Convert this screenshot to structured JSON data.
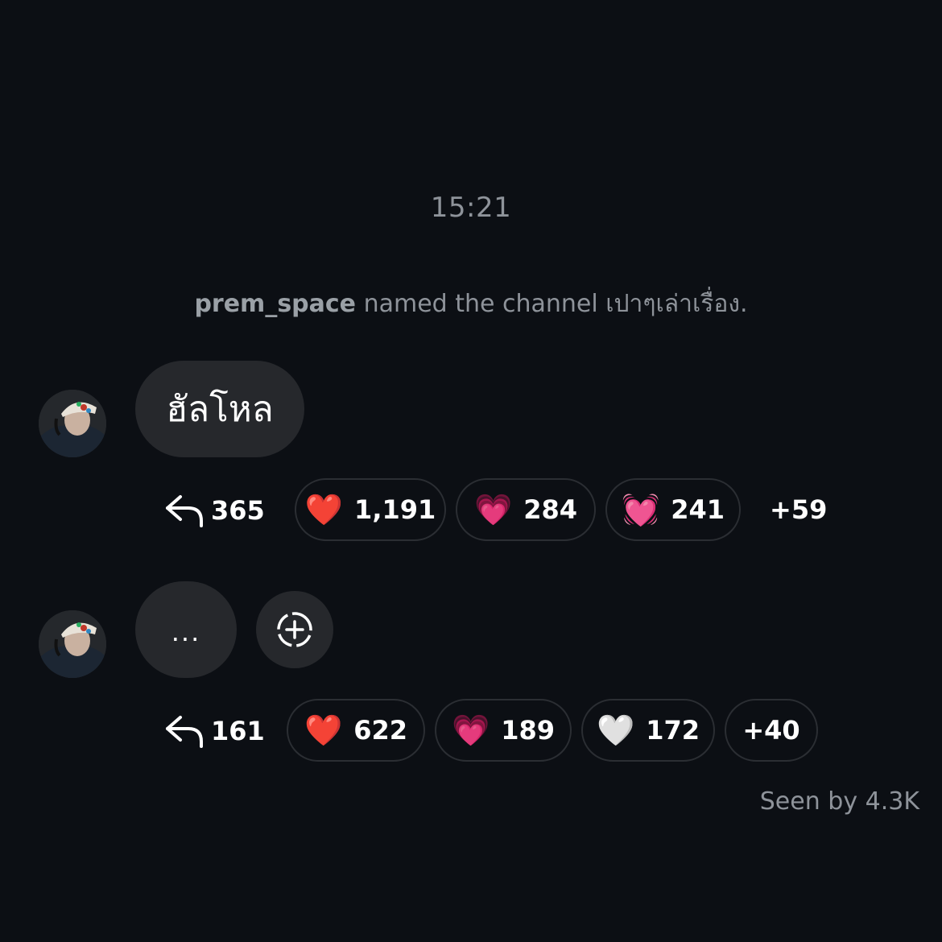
{
  "timestamp": "15:21",
  "system_message": {
    "username": "prem_space",
    "text": " named the channel เปาๆเล่าเรื่อง."
  },
  "messages": [
    {
      "text": "ฮัลโหล",
      "reply_count": "365",
      "reactions": [
        {
          "emoji": "❤️",
          "count": "1,191"
        },
        {
          "emoji": "💗",
          "count": "284"
        },
        {
          "emoji": "💓",
          "count": "241"
        }
      ],
      "more": "+59"
    },
    {
      "text": "...",
      "reply_count": "161",
      "reactions": [
        {
          "emoji": "❤️",
          "count": "622"
        },
        {
          "emoji": "💗",
          "count": "189"
        },
        {
          "emoji": "🤍",
          "count": "172"
        }
      ],
      "more": "+40"
    }
  ],
  "seen_by": "Seen by 4.3K",
  "icons": {
    "reply": "reply-arrow-icon",
    "add_reaction": "add-reaction-icon"
  },
  "colors": {
    "background": "#0c0f14",
    "bubble": "#26282c",
    "muted_text": "#8e939a"
  }
}
